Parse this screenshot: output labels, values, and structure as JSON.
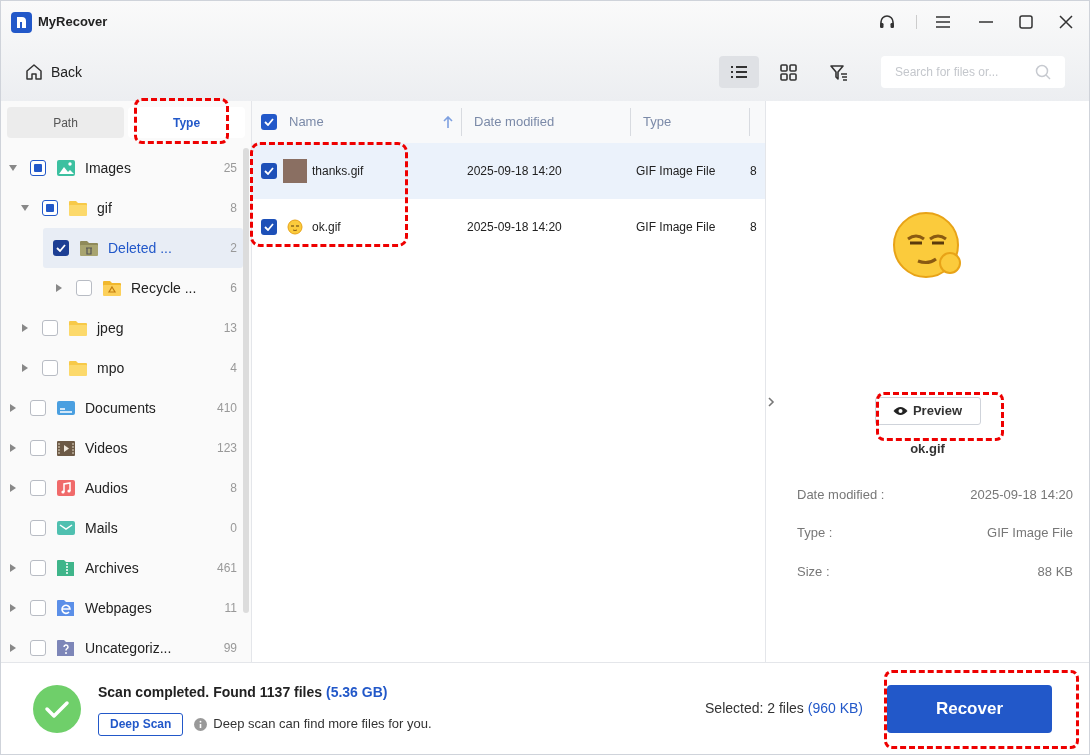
{
  "app": {
    "title": "MyRecover"
  },
  "toolbar": {
    "back": "Back",
    "views": [
      {
        "kind": "list",
        "selected": true
      },
      {
        "kind": "grid",
        "selected": false
      },
      {
        "kind": "filter",
        "selected": false
      }
    ],
    "search": {
      "placeholder": "Search for files or..."
    }
  },
  "left_tabs": [
    {
      "label": "Path",
      "selected": false
    },
    {
      "label": "Type",
      "selected": true
    }
  ],
  "tree": [
    {
      "label": "Images",
      "count": "25",
      "kind": "image",
      "expanded": true,
      "checked": false,
      "partial": true,
      "selected": false,
      "children": [
        {
          "label": "gif",
          "count": "8",
          "kind": "folder",
          "expanded": true,
          "checked": false,
          "partial": true,
          "selected": false,
          "children": [
            {
              "label": "Deleted ...",
              "count": "2",
              "kind": "trash",
              "checked": true,
              "selected": true
            },
            {
              "label": "Recycle ...",
              "count": "6",
              "kind": "recycle",
              "expanded": false,
              "checked": false,
              "selected": false
            }
          ]
        },
        {
          "label": "jpeg",
          "count": "13",
          "kind": "folder",
          "expanded": false,
          "checked": false,
          "selected": false
        },
        {
          "label": "mpo",
          "count": "4",
          "kind": "folder",
          "expanded": false,
          "checked": false,
          "selected": false
        }
      ]
    },
    {
      "label": "Documents",
      "count": "410",
      "kind": "document",
      "expanded": false,
      "checked": false,
      "selected": false
    },
    {
      "label": "Videos",
      "count": "123",
      "kind": "video",
      "expanded": false,
      "checked": false,
      "selected": false
    },
    {
      "label": "Audios",
      "count": "8",
      "kind": "audio",
      "expanded": false,
      "checked": false,
      "selected": false
    },
    {
      "label": "Mails",
      "count": "0",
      "kind": "mail",
      "checked": false,
      "selected": false
    },
    {
      "label": "Archives",
      "count": "461",
      "kind": "archive",
      "expanded": false,
      "checked": false,
      "selected": false
    },
    {
      "label": "Webpages",
      "count": "11",
      "kind": "web",
      "expanded": false,
      "checked": false,
      "selected": false
    },
    {
      "label": "Uncategoriz...",
      "count": "99",
      "kind": "unknown",
      "expanded": false,
      "checked": false,
      "selected": false
    }
  ],
  "table": {
    "all_checked": true,
    "columns": [
      "Name",
      "Date modified",
      "Type"
    ],
    "rows": [
      {
        "name": "thanks.gif",
        "kind": "photo",
        "date": "2025-09-18 14:20",
        "type": "GIF Image File",
        "column_4": "8",
        "checked": true,
        "selected": true
      },
      {
        "name": "ok.gif",
        "kind": "emoji",
        "date": "2025-09-18 14:20",
        "type": "GIF Image File",
        "column_4": "8",
        "checked": true,
        "selected": false
      }
    ]
  },
  "preview": {
    "button": "Preview",
    "file_name": "ok.gif",
    "details": [
      {
        "label": "Date modified :",
        "value": "2025-09-18 14:20"
      },
      {
        "label": "Type :",
        "value": "GIF Image File"
      },
      {
        "label": "Size :",
        "value": "88 KB"
      }
    ]
  },
  "status": {
    "message": "Scan completed. Found 1137 files",
    "size": "(5.36 GB)",
    "deep_scan": "Deep Scan",
    "hint": "Deep scan can find more files for you.",
    "selected": "Selected: 2 files",
    "selected_size": "(960 KB)",
    "recover": "Recover"
  }
}
